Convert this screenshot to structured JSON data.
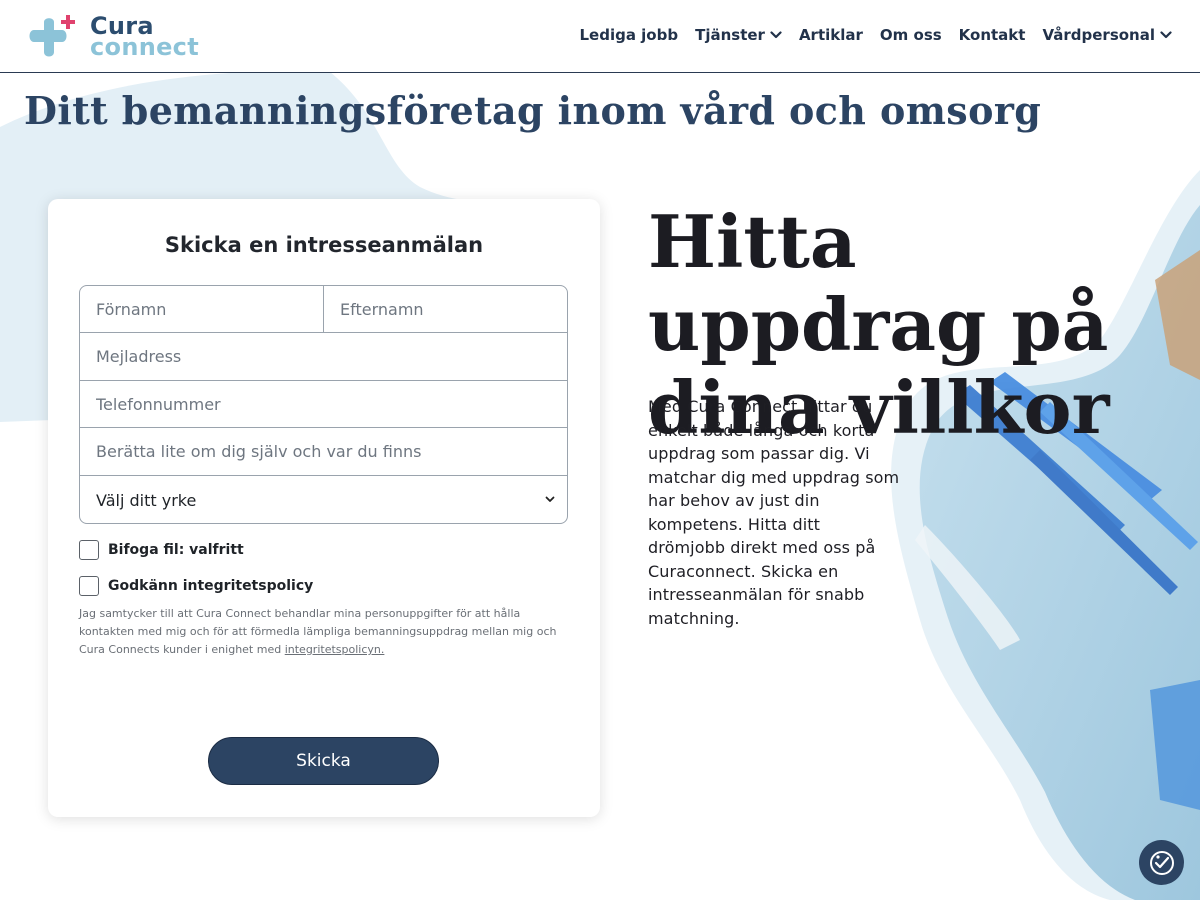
{
  "logo": {
    "line1": "Cura",
    "line2": "connect"
  },
  "nav": {
    "items": [
      {
        "label": "Lediga jobb",
        "dropdown": false
      },
      {
        "label": "Tjänster",
        "dropdown": true
      },
      {
        "label": "Artiklar",
        "dropdown": false
      },
      {
        "label": "Om oss",
        "dropdown": false
      },
      {
        "label": "Kontakt",
        "dropdown": false
      },
      {
        "label": "Vårdpersonal",
        "dropdown": true
      }
    ]
  },
  "tagline": "Ditt bemanningsföretag inom vård och omsorg",
  "form": {
    "title": "Skicka en intresseanmälan",
    "first_name_placeholder": "Förnamn",
    "last_name_placeholder": "Efternamn",
    "email_placeholder": "Mejladress",
    "phone_placeholder": "Telefonnummer",
    "about_placeholder": "Berätta lite om dig själv och var du finns",
    "profession_select": "Välj ditt yrke",
    "attach_label": "Bifoga fil: valfritt",
    "policy_label": "Godkänn integritetspolicy",
    "consent_text": "Jag samtycker till att Cura Connect behandlar mina personuppgifter för att hålla kontakten med mig och för att förmedla lämpliga bemanningsuppdrag mellan mig och Cura Connects kunder i enighet med",
    "consent_link": "integritetspolicyn.",
    "submit_label": "Skicka"
  },
  "hero": {
    "title": "Hitta uppdrag på dina villkor",
    "text": "Med Cura Connect hittar du enkelt både långa och korta uppdrag som passar dig. Vi matchar dig med uppdrag som har behov av just din kompetens. Hitta ditt drömjobb direkt med oss på Curaconnect. Skicka en intresseanmälan för snabb matchning."
  },
  "colors": {
    "navy": "#2c4463",
    "logo_light_blue": "#8cc3d8",
    "logo_pink": "#e0426e",
    "blob_light": "#e3eff6",
    "photo_blue": "#b9d7e7"
  },
  "icons": {
    "dropdown": "chevron-down-icon",
    "accessibility": "accessibility-icon"
  }
}
